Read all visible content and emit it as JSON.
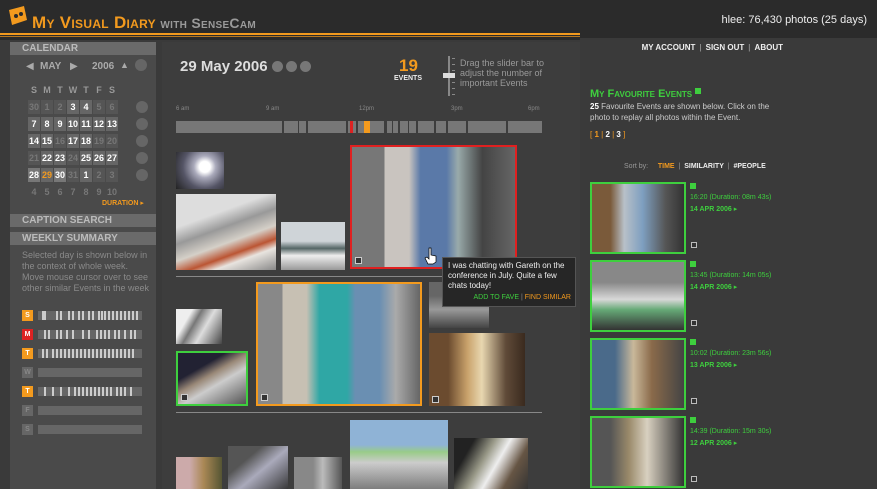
{
  "header": {
    "brand_main": "My Visual Diary",
    "brand_sub": "with SenseCam",
    "user_info": "hlee: 76,430 photos (25 days)"
  },
  "nav": {
    "account": "MY ACCOUNT",
    "signout": "SIGN OUT",
    "about": "ABOUT"
  },
  "calendar": {
    "heading": "CALENDAR",
    "month": "MAY",
    "year": "2006",
    "weekdays": [
      "S",
      "M",
      "T",
      "W",
      "T",
      "F",
      "S"
    ],
    "rows": [
      [
        [
          "30",
          "dim"
        ],
        [
          "1",
          "dim"
        ],
        [
          "2",
          "dim"
        ],
        [
          "3",
          "a"
        ],
        [
          "4",
          "a"
        ],
        [
          "5",
          "dim"
        ],
        [
          "6",
          "dim"
        ]
      ],
      [
        [
          "7",
          "a"
        ],
        [
          "8",
          "a"
        ],
        [
          "9",
          "a"
        ],
        [
          "10",
          "a"
        ],
        [
          "11",
          "a"
        ],
        [
          "12",
          "a"
        ],
        [
          "13",
          "a"
        ]
      ],
      [
        [
          "14",
          "a"
        ],
        [
          "15",
          "a"
        ],
        [
          "16",
          "dim"
        ],
        [
          "17",
          "a"
        ],
        [
          "18",
          "a"
        ],
        [
          "19",
          "dim"
        ],
        [
          "20",
          "dim"
        ]
      ],
      [
        [
          "21",
          "dim"
        ],
        [
          "22",
          "a"
        ],
        [
          "23",
          "a"
        ],
        [
          "24",
          "dim"
        ],
        [
          "25",
          "a"
        ],
        [
          "26",
          "a"
        ],
        [
          "27",
          "a"
        ]
      ],
      [
        [
          "28",
          "wk"
        ],
        [
          "29",
          "sel"
        ],
        [
          "30",
          "wk"
        ],
        [
          "31",
          "dim"
        ],
        [
          "1",
          "a"
        ],
        [
          "2",
          "dim"
        ],
        [
          "3",
          "dim"
        ]
      ],
      [
        [
          "4",
          ""
        ],
        [
          "5",
          ""
        ],
        [
          "6",
          ""
        ],
        [
          "7",
          ""
        ],
        [
          "8",
          ""
        ],
        [
          "9",
          ""
        ],
        [
          "10",
          ""
        ]
      ]
    ],
    "duration": "DURATION ▸"
  },
  "caption_search": "CAPTION SEARCH",
  "weekly": {
    "heading": "WEEKLY SUMMARY",
    "text": "Selected day is shown below in the context of whole week. Move mouse cursor over to see other similar Events in the week",
    "days": [
      {
        "label": "S",
        "style": "",
        "ticks": [
          4,
          6,
          18,
          22,
          30,
          34,
          40,
          44,
          50,
          54,
          60,
          63,
          66,
          70,
          74,
          78,
          82,
          86,
          90,
          94,
          98
        ]
      },
      {
        "label": "M",
        "style": "red",
        "ticks": [
          6,
          10,
          18,
          22,
          28,
          34,
          44,
          50,
          58,
          62,
          66,
          70,
          76,
          80,
          86,
          92,
          96
        ]
      },
      {
        "label": "T",
        "style": "",
        "ticks": [
          4,
          8,
          14,
          18,
          22,
          26,
          30,
          34,
          38,
          42,
          46,
          50,
          54,
          58,
          62,
          66,
          70,
          74,
          78,
          82,
          86,
          90,
          94
        ]
      },
      {
        "label": "W",
        "style": "off",
        "ticks": []
      },
      {
        "label": "T",
        "style": "",
        "ticks": [
          6,
          14,
          22,
          30,
          36,
          40,
          44,
          48,
          52,
          56,
          60,
          64,
          68,
          72,
          78,
          82,
          86,
          92
        ]
      },
      {
        "label": "F",
        "style": "off",
        "ticks": []
      },
      {
        "label": "S",
        "style": "off",
        "ticks": []
      }
    ]
  },
  "main": {
    "date": "29 May 2006",
    "events_count": "19",
    "events_label": "EVENTS",
    "slider_hint": "Drag the slider bar to adjust the number of important Events",
    "timeline_labels": [
      "6 am",
      "9 am",
      "12pm",
      "3pm",
      "6pm"
    ],
    "tooltip_text": "I was chatting with Gareth on the conference in July. Quite a few chats today!",
    "add_to_fave": "ADD TO FAVE",
    "find_similar": "FIND SIMILAR"
  },
  "favourites": {
    "title": "My Favourite Events",
    "count": "25",
    "desc": " Favourite Events are shown below.  Click on the photo to replay all photos within the Event.",
    "pages": [
      "1",
      "2",
      "3"
    ],
    "sort_label": "Sort by:",
    "sort_time": "TIME",
    "sort_similarity": "SIMILARITY",
    "sort_people": "#PEOPLE",
    "items": [
      {
        "time": "16:20 (Duration: 08m 43s)",
        "date": "14 APR 2006  ▸"
      },
      {
        "time": "13:45 (Duration: 14m 05s)",
        "date": "14 APR 2006  ▸"
      },
      {
        "time": "10:02 (Duration: 23m 56s)",
        "date": "13 APR 2006  ▸"
      },
      {
        "time": "14:39 (Duration: 15m 30s)",
        "date": "12 APR 2006  ▸"
      }
    ]
  },
  "colors": {
    "accent": "#f39a1e",
    "fave": "#3ecf3e",
    "sidebar": "#4a4a4a",
    "background": "#3a3a3a"
  }
}
